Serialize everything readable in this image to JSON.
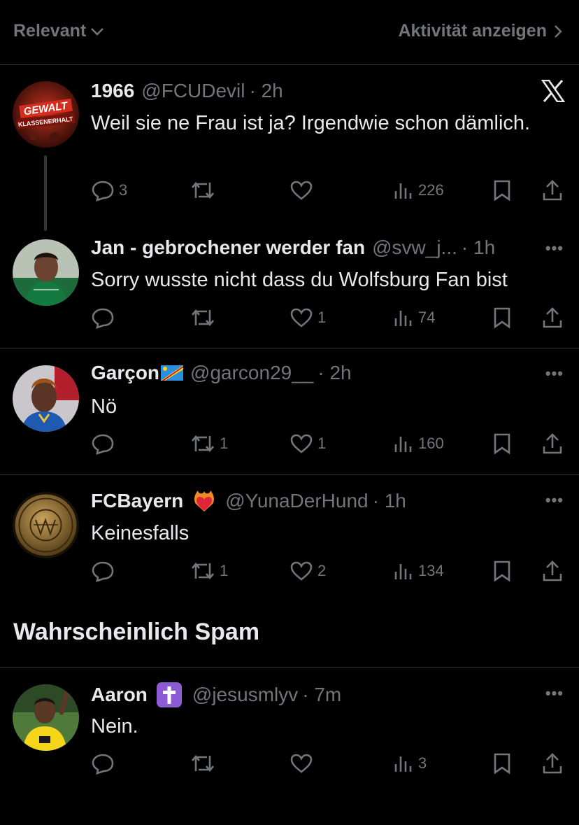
{
  "header": {
    "sort_label": "Relevant",
    "activity_label": "Aktivität anzeigen"
  },
  "tweets": [
    {
      "name": "1966",
      "handle": "@FCUDevil",
      "time": "· 2h",
      "text": "Weil sie ne Frau ist ja? Irgendwie schon dämlich.",
      "replies": "3",
      "retweets": "",
      "likes": "",
      "views": "226",
      "avatar_text": "GEWALT KLASSENERHALT"
    },
    {
      "name": "Jan - gebrochener werder fan",
      "handle": "@svw_j...",
      "time": "· 1h",
      "text": "Sorry wusste nicht dass du Wolfsburg Fan bist",
      "replies": "",
      "retweets": "",
      "likes": "1",
      "views": "74"
    },
    {
      "name": "Garçon",
      "handle": "@garcon29__",
      "time": "· 2h",
      "text": "Nö",
      "replies": "",
      "retweets": "1",
      "likes": "1",
      "views": "160"
    },
    {
      "name": "FCBayern",
      "handle": "@YunaDerHund",
      "time": "· 1h",
      "text": "Keinesfalls",
      "replies": "",
      "retweets": "1",
      "likes": "2",
      "views": "134"
    }
  ],
  "spam_section": {
    "title": "Wahrscheinlich Spam",
    "tweet": {
      "name": "Aaron",
      "handle": "@jesusmlyv",
      "time": "· 7m",
      "text": "Nein.",
      "replies": "",
      "retweets": "",
      "likes": "",
      "views": "3"
    }
  },
  "colors": {
    "background": "#000000",
    "text": "#e7e9ea",
    "secondary": "#71767b",
    "divider": "#2f3336"
  }
}
